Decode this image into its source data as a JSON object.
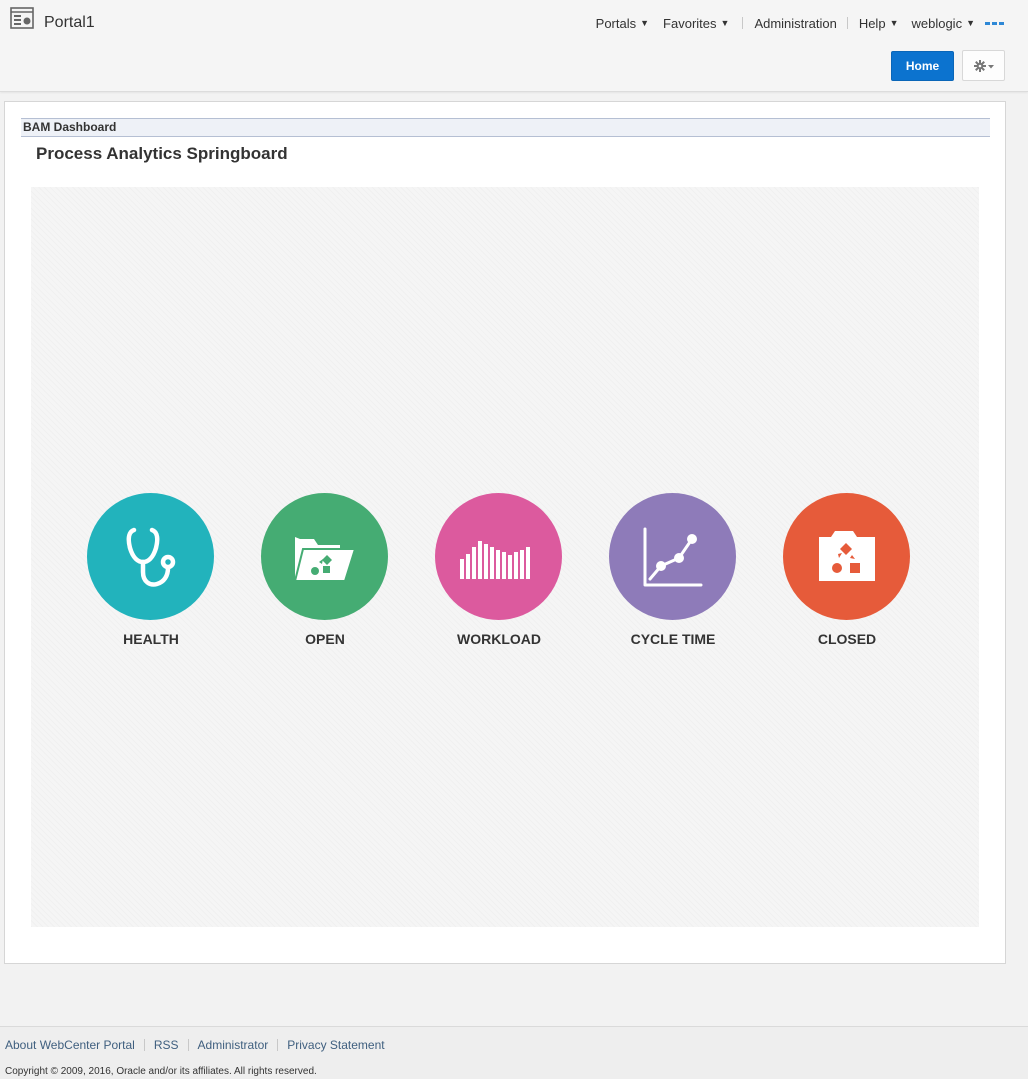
{
  "header": {
    "portal_title": "Portal1",
    "nav": {
      "portals": "Portals",
      "favorites": "Favorites",
      "administration": "Administration",
      "help": "Help",
      "user": "weblogic"
    },
    "home_label": "Home",
    "accent_color": "#0c73cf"
  },
  "main": {
    "bam_header": "BAM Dashboard",
    "page_title": "Process Analytics Springboard",
    "tiles": [
      {
        "label": "HEALTH",
        "color": "#22b3bc",
        "icon": "stethoscope-icon"
      },
      {
        "label": "OPEN",
        "color": "#45ac73",
        "icon": "open-folder-icon"
      },
      {
        "label": "WORKLOAD",
        "color": "#dc5a9e",
        "icon": "bar-chart-icon"
      },
      {
        "label": "CYCLE TIME",
        "color": "#8e7bb9",
        "icon": "line-chart-icon"
      },
      {
        "label": "CLOSED",
        "color": "#e65b3a",
        "icon": "closed-folder-icon"
      }
    ]
  },
  "footer": {
    "links": [
      "About WebCenter Portal",
      "RSS",
      "Administrator",
      "Privacy Statement"
    ],
    "copyright": "Copyright © 2009, 2016, Oracle and/or its affiliates. All rights reserved."
  }
}
